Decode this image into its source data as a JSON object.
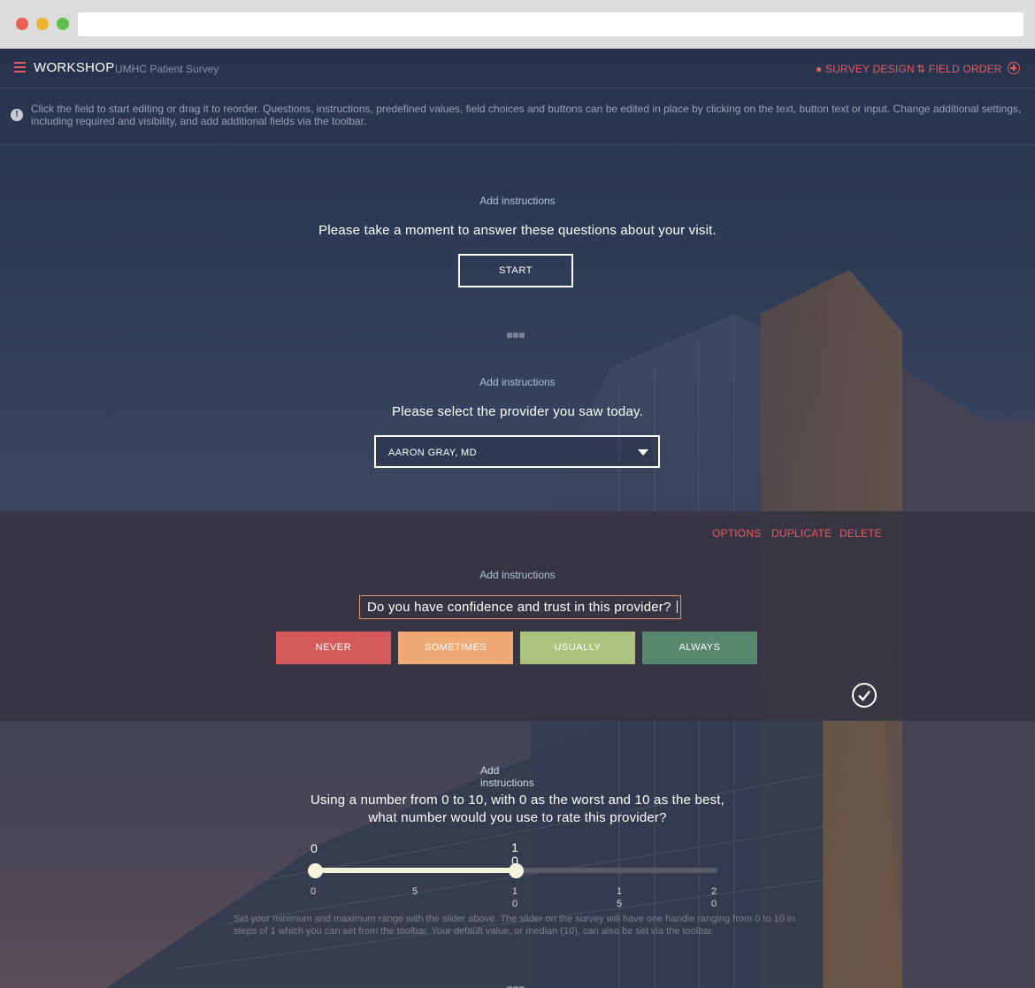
{
  "nav": {
    "brand": "WORKSHOP",
    "subtitle": "UMHC Patient Survey",
    "survey_design": "SURVEY DESIGN",
    "field_order": "FIELD ORDER"
  },
  "info": {
    "text": "Click the field to start editing or drag it to reorder. Questions, instructions, predefined values, field choices and buttons can be edited in place by clicking on the text, button text or input. Change additional settings, including required and visibility, and add additional fields via the toolbar."
  },
  "fields": {
    "intro": {
      "add_instructions": "Add instructions",
      "question": "Please take a moment to answer these questions about your visit.",
      "button": "START"
    },
    "provider": {
      "add_instructions": "Add instructions",
      "question": "Please select the provider you saw today.",
      "selected": "AARON GRAY, MD"
    },
    "trust": {
      "options": "OPTIONS",
      "duplicate": "DUPLICATE",
      "delete": "DELETE",
      "add_instructions": "Add instructions",
      "question": "Do you have confidence and trust in this provider?",
      "choices": [
        "NEVER",
        "SOMETIMES",
        "USUALLY",
        "ALWAYS"
      ]
    },
    "rating": {
      "add_instructions_1": "Add",
      "add_instructions_2": "instructions",
      "question_line1": "Using a number from 0 to 10, with 0 as the worst and 10 as the best,",
      "question_line2": "what number would you use to rate this provider?",
      "min_value": "0",
      "max_value_1": "1",
      "max_value_2": "0",
      "ticks": [
        {
          "a": "0",
          "b": ""
        },
        {
          "a": "5",
          "b": ""
        },
        {
          "a": "1",
          "b": "0"
        },
        {
          "a": "1",
          "b": "5"
        },
        {
          "a": "2",
          "b": "0"
        }
      ],
      "help": "Set your minimum and maximum range with the slider above. The slider on the survey will have one handle ranging from 0 to 10 in steps of 1 which you can set from the toolbar. Your default value, or median (10), can also be set via the toolbar."
    }
  },
  "colors": {
    "accent": "#e35d62",
    "never": "#d55a5a",
    "sometimes": "#eda874",
    "usually": "#acc37e",
    "always": "#58876f"
  }
}
